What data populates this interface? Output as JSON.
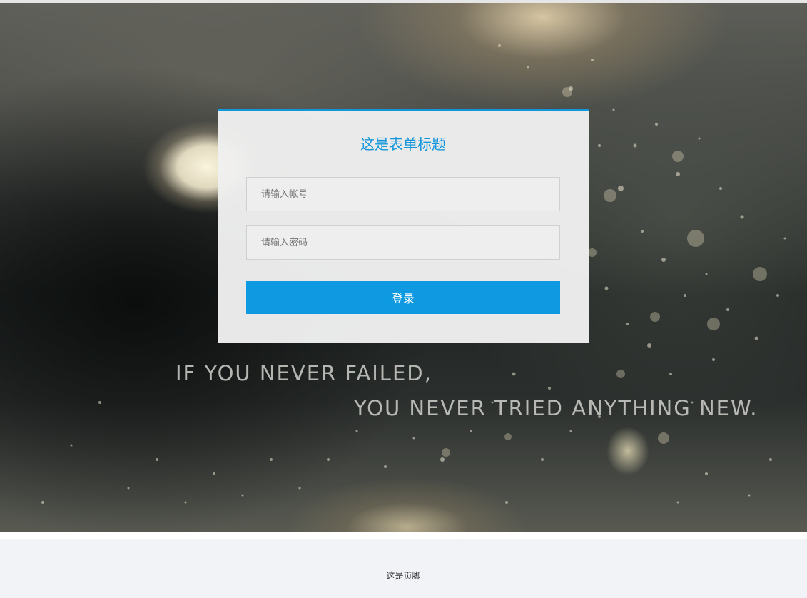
{
  "login_form": {
    "title": "这是表单标题",
    "account_placeholder": "请输入帐号",
    "password_placeholder": "请输入密码",
    "submit_label": "登录"
  },
  "background_quote": {
    "line1": "IF YOU NEVER FAILED,",
    "line2": "YOU NEVER TRIED ANYTHING NEW."
  },
  "footer": {
    "text": "这是页脚"
  },
  "colors": {
    "accent": "#1296db",
    "button": "#0e99e0",
    "footer_bg": "#f1f3f6"
  }
}
